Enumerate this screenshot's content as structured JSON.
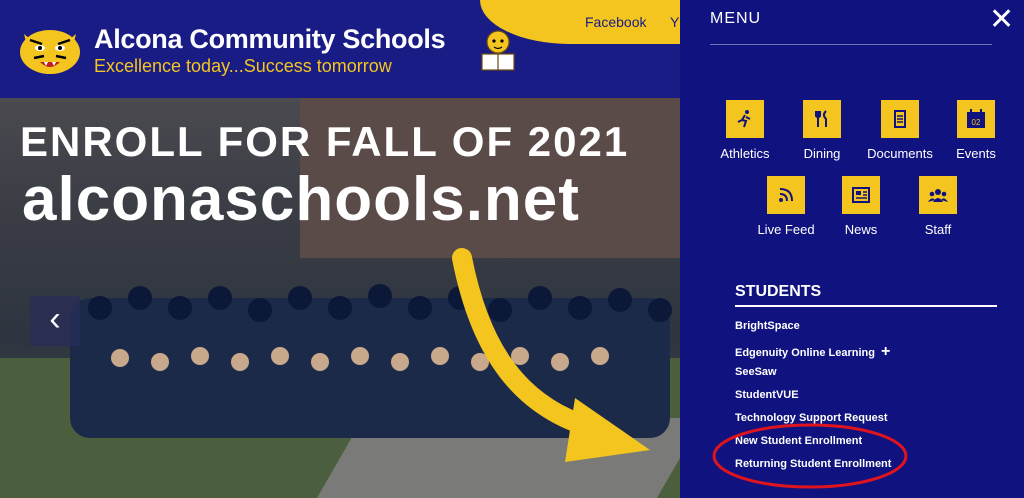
{
  "header": {
    "school_name": "Alcona Community Schools",
    "tagline": "Excellence today...Success tomorrow",
    "links": [
      "Facebook",
      "Y"
    ]
  },
  "hero": {
    "line1": "ENROLL FOR FALL OF 2021",
    "line2": "alconaschools.net",
    "prev_icon": "‹"
  },
  "menu": {
    "title": "MENU",
    "close_icon": "✕",
    "quick_links": [
      {
        "label": "Athletics",
        "icon": "runner-icon"
      },
      {
        "label": "Dining",
        "icon": "utensils-icon"
      },
      {
        "label": "Documents",
        "icon": "document-icon"
      },
      {
        "label": "Events",
        "icon": "calendar-icon",
        "badge": "02"
      },
      {
        "label": "Live Feed",
        "icon": "rss-icon"
      },
      {
        "label": "News",
        "icon": "newspaper-icon"
      },
      {
        "label": "Staff",
        "icon": "users-icon"
      }
    ],
    "section_title": "STUDENTS",
    "student_links": [
      "BrightSpace",
      "Edgenuity Online Learning",
      "SeeSaw",
      "StudentVUE",
      "Technology Support Request",
      "New Student Enrollment",
      "Returning Student Enrollment"
    ],
    "expand_icon": "+"
  },
  "colors": {
    "navy": "#10137f",
    "gold": "#f4c51f",
    "annotation_red": "#e0141e"
  }
}
